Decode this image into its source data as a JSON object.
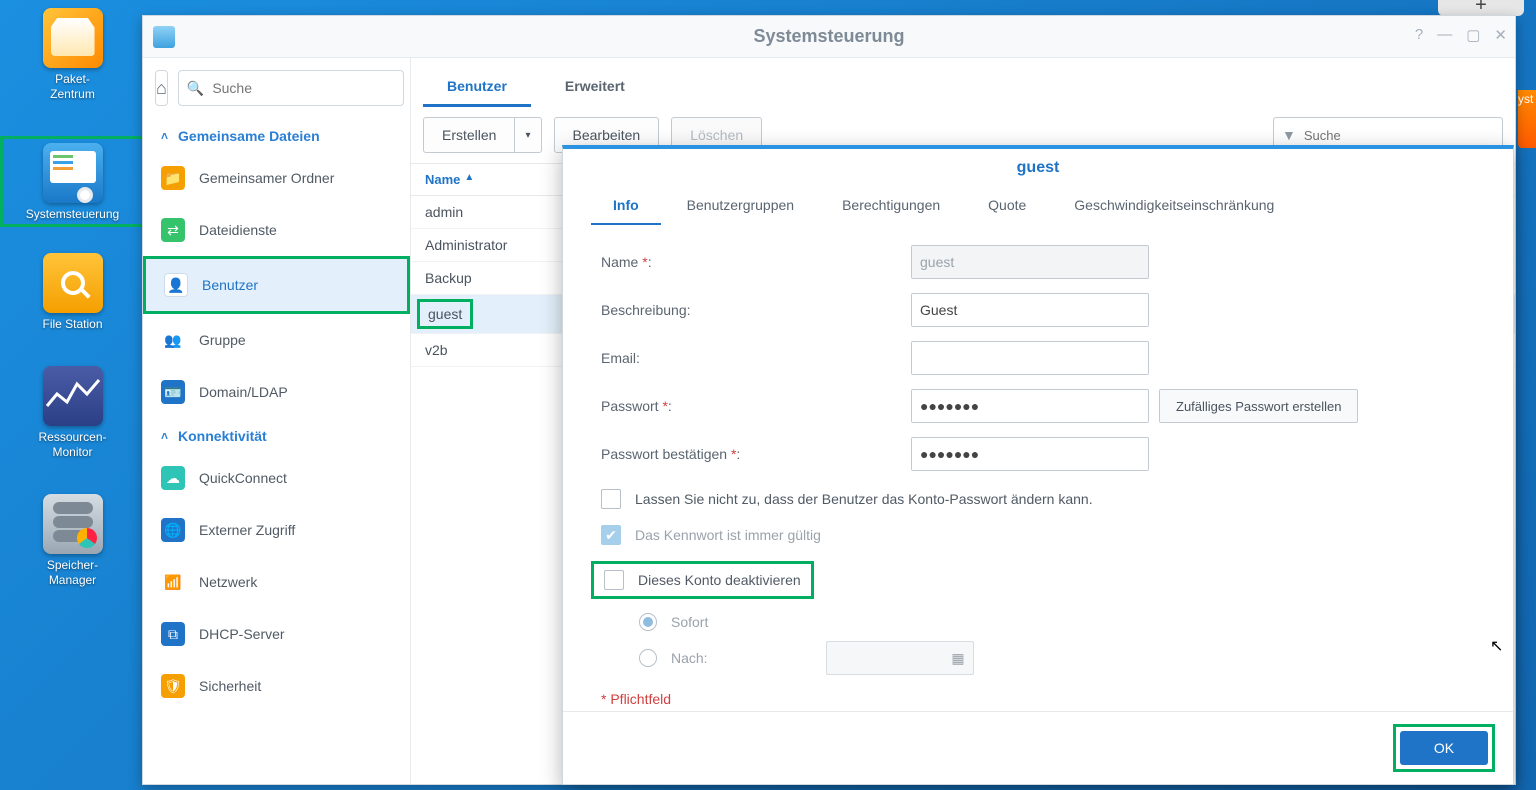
{
  "desktop": {
    "items": [
      {
        "label": "Paket-\nZentrum"
      },
      {
        "label": "Systemsteuerung"
      },
      {
        "label": "File Station"
      },
      {
        "label": "Ressourcen-\nMonitor"
      },
      {
        "label": "Speicher-\nManager"
      }
    ]
  },
  "window": {
    "title": "Systemsteuerung"
  },
  "sidebar": {
    "search_placeholder": "Suche",
    "groups": [
      {
        "label": "Gemeinsame Dateien"
      },
      {
        "label": "Konnektivität"
      }
    ],
    "items_g1": [
      {
        "label": "Gemeinsamer Ordner"
      },
      {
        "label": "Dateidienste"
      },
      {
        "label": "Benutzer"
      },
      {
        "label": "Gruppe"
      },
      {
        "label": "Domain/LDAP"
      }
    ],
    "items_g2": [
      {
        "label": "QuickConnect"
      },
      {
        "label": "Externer Zugriff"
      },
      {
        "label": "Netzwerk"
      },
      {
        "label": "DHCP-Server"
      },
      {
        "label": "Sicherheit"
      }
    ]
  },
  "main": {
    "tabs": [
      {
        "label": "Benutzer"
      },
      {
        "label": "Erweitert"
      }
    ],
    "toolbar": {
      "create": "Erstellen",
      "edit": "Bearbeiten",
      "delete": "Löschen",
      "search_placeholder": "Suche"
    },
    "table": {
      "header": "Name",
      "rows": [
        "admin",
        "Administrator",
        "Backup",
        "guest",
        "v2b"
      ]
    }
  },
  "modal": {
    "title": "guest",
    "tabs": [
      {
        "label": "Info"
      },
      {
        "label": "Benutzergruppen"
      },
      {
        "label": "Berechtigungen"
      },
      {
        "label": "Quote"
      },
      {
        "label": "Geschwindigkeitseinschränkung"
      }
    ],
    "form": {
      "name_label": "Name",
      "name_value": "guest",
      "desc_label": "Beschreibung:",
      "desc_value": "Guest",
      "email_label": "Email:",
      "email_value": "",
      "pass_label": "Passwort",
      "pass_value": "●●●●●●●",
      "pass2_label": "Passwort bestätigen",
      "pass2_value": "●●●●●●●",
      "rand_btn": "Zufälliges Passwort erstellen",
      "chk1": "Lassen Sie nicht zu, dass der Benutzer das Konto-Passwort ändern kann.",
      "chk2": "Das Kennwort ist immer gültig",
      "chk3": "Dieses Konto deaktivieren",
      "radio1": "Sofort",
      "radio2": "Nach:",
      "pflicht": "Pflichtfeld"
    },
    "ok": "OK"
  }
}
